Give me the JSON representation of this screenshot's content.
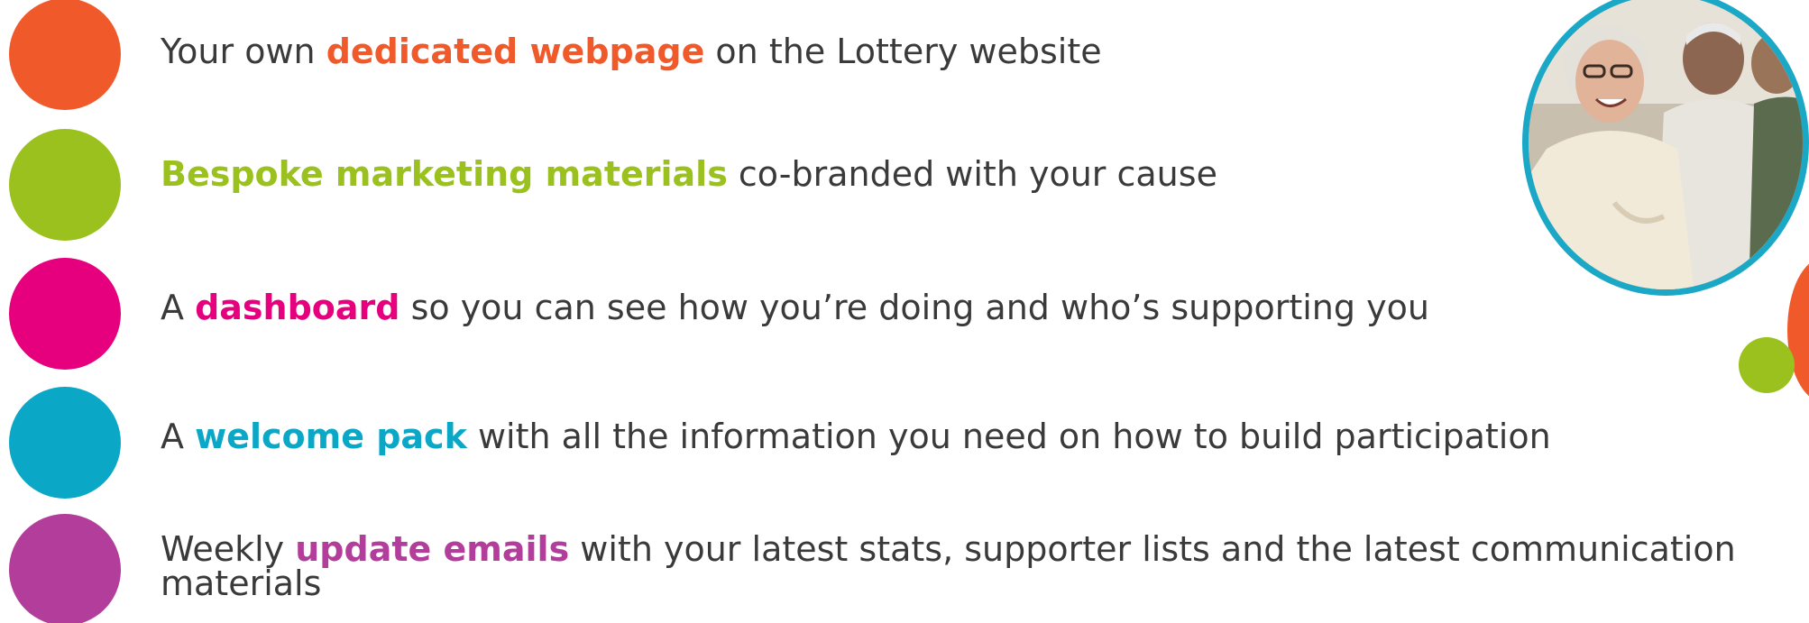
{
  "colors": {
    "orange": "#f05a2b",
    "green": "#9bc11f",
    "pink": "#e6007e",
    "teal": "#0aa7c6",
    "purple": "#b33d9a",
    "text": "#3a3a3a",
    "frame": "#1ba8c7"
  },
  "items": [
    {
      "pre": "Your own ",
      "highlight": "dedicated webpage",
      "post": " on the Lottery website"
    },
    {
      "pre": "",
      "highlight": "Bespoke marketing materials",
      "post": " co-branded with your cause"
    },
    {
      "pre": "A ",
      "highlight": "dashboard",
      "post": " so you can see how you’re doing and who’s supporting you"
    },
    {
      "pre": "A ",
      "highlight": "welcome pack",
      "post": " with all the information you need on how to build participation"
    },
    {
      "pre": "Weekly ",
      "highlight": "update emails",
      "post": " with your latest stats, supporter lists and the latest communication materials"
    }
  ],
  "photo": {
    "subject": "seniors-laughing-photo"
  }
}
